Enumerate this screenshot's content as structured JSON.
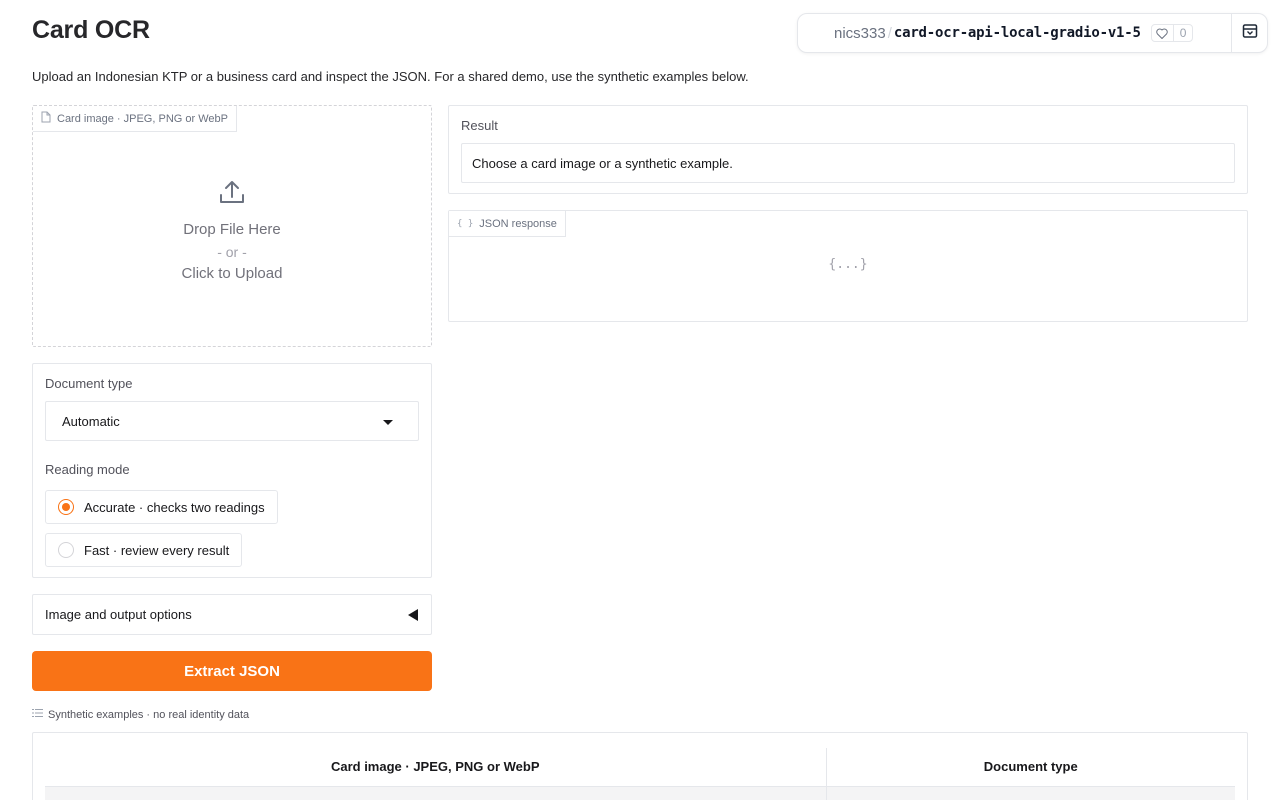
{
  "page": {
    "title": "Card OCR",
    "description": "Upload an Indonesian KTP or a business card and inspect the JSON. For a shared demo, use the synthetic examples below."
  },
  "space_header": {
    "owner": "nics333",
    "separator": "/",
    "space_name": "card-ocr-api-local-gradio-v1-5",
    "likes": "0",
    "heart_icon": "heart-icon",
    "menu_icon": "panel-icon"
  },
  "upload": {
    "label": "Card image · JPEG, PNG or WebP",
    "drop_text": "Drop File Here",
    "or_text": "- or -",
    "click_text": "Click to Upload"
  },
  "document_type": {
    "label": "Document type",
    "selected": "Automatic"
  },
  "reading_mode": {
    "label": "Reading mode",
    "options": [
      {
        "label": "Accurate · checks two readings",
        "checked": true
      },
      {
        "label": "Fast · review every result",
        "checked": false
      }
    ]
  },
  "accordion": {
    "label": "Image and output options"
  },
  "extract_button": {
    "label": "Extract JSON"
  },
  "result": {
    "label": "Result",
    "value": "Choose a card image or a synthetic example."
  },
  "json_response": {
    "label": "JSON response",
    "empty_text": "{...}"
  },
  "examples": {
    "label": "Synthetic examples · no real identity data",
    "headers": [
      "Card image · JPEG, PNG or WebP",
      "Document type"
    ]
  },
  "colors": {
    "accent": "#f97316",
    "border": "#e5e7eb"
  }
}
